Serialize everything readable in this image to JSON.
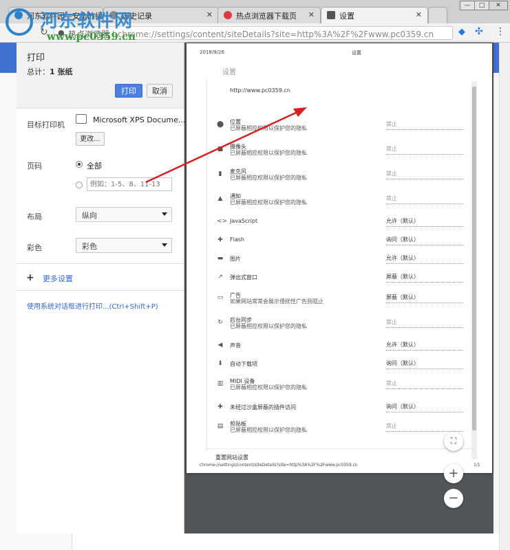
{
  "browser": {
    "tabs": [
      {
        "label": "河东软件园—安全的绿色"
      },
      {
        "label": "历史记录"
      },
      {
        "label": "热点浏览器下载页"
      },
      {
        "label": "设置"
      }
    ],
    "address_prefix": "热点浏览器",
    "address_sep": "|",
    "address_url_path": "chrome://settings/content/siteDetails?site=http%3A%2F%2Fwww.pc0359.cn",
    "watermark_title": "河东软件网",
    "watermark_url": "www.pc0359.cn"
  },
  "print_panel": {
    "title": "打印",
    "total_prefix": "总计：",
    "total_value": "1 张纸",
    "print_button": "打印",
    "cancel_button": "取消",
    "destination_label": "目标打印机",
    "destination_value": "Microsoft XPS Docume...",
    "change_button": "更改...",
    "pages_label": "页码",
    "pages_all": "全部",
    "pages_placeholder": "例如：1-5、8、11-13",
    "layout_label": "布局",
    "layout_value": "纵向",
    "color_label": "彩色",
    "color_value": "彩色",
    "more_settings": "更多设置",
    "system_dialog_link": "使用系统对话框进行打印...(Ctrl+Shift+P)"
  },
  "preview": {
    "date": "2018/9/26",
    "header_title": "设置",
    "breadcrumb": "设置",
    "site": "http://www.pc0359.cn",
    "rows": [
      {
        "icon": "location-icon",
        "glyph": "⬤",
        "name": "位置",
        "desc": "已屏蔽相应权限以保护您的隐私",
        "value": "禁止",
        "off": true
      },
      {
        "icon": "camera-icon",
        "glyph": "■",
        "name": "摄像头",
        "desc": "已屏蔽相应权限以保护您的隐私",
        "value": "禁止",
        "off": true
      },
      {
        "icon": "microphone-icon",
        "glyph": "▮",
        "name": "麦克风",
        "desc": "已屏蔽相应权限以保护您的隐私",
        "value": "禁止",
        "off": true
      },
      {
        "icon": "bell-icon",
        "glyph": "▲",
        "name": "通知",
        "desc": "已屏蔽相应权限以保护您的隐私",
        "value": "禁止",
        "off": true
      },
      {
        "icon": "code-icon",
        "glyph": "<>",
        "name": "JavaScript",
        "desc": "",
        "value": "允许（默认）",
        "off": false
      },
      {
        "icon": "puzzle-icon",
        "glyph": "✚",
        "name": "Flash",
        "desc": "",
        "value": "询问（默认）",
        "off": false
      },
      {
        "icon": "image-icon",
        "glyph": "▬",
        "name": "图片",
        "desc": "",
        "value": "允许（默认）",
        "off": false
      },
      {
        "icon": "popup-icon",
        "glyph": "↗",
        "name": "弹出式窗口",
        "desc": "",
        "value": "屏蔽（默认）",
        "off": false
      },
      {
        "icon": "ad-icon",
        "glyph": "▭",
        "name": "广告",
        "desc": "如果网站常常会展示侵扰性广告则阻止",
        "value": "屏蔽（默认）",
        "off": false
      },
      {
        "icon": "sync-icon",
        "glyph": "↻",
        "name": "后台同步",
        "desc": "已屏蔽相应权限以保护您的隐私",
        "value": "禁止",
        "off": true
      },
      {
        "icon": "sound-icon",
        "glyph": "◀",
        "name": "声音",
        "desc": "",
        "value": "允许（默认）",
        "off": false
      },
      {
        "icon": "download-icon",
        "glyph": "⬇",
        "name": "自动下载项",
        "desc": "",
        "value": "询问（默认）",
        "off": false
      },
      {
        "icon": "midi-icon",
        "glyph": "▥",
        "name": "MIDI 设备",
        "desc": "已屏蔽相应权限以保护您的隐私",
        "value": "禁止",
        "off": true
      },
      {
        "icon": "plugin-icon",
        "glyph": "✚",
        "name": "未经过沙盒屏蔽的插件访问",
        "desc": "",
        "value": "询问（默认）",
        "off": false
      },
      {
        "icon": "clipboard-icon",
        "glyph": "▤",
        "name": "剪贴板",
        "desc": "已屏蔽相应权限以保护您的隐私",
        "value": "禁止",
        "off": true
      }
    ],
    "reset_label": "重置网站设置",
    "footer_url": "chrome://settings/content/siteDetails?site=http%3A%2F%2Fwww.pc0359.cn",
    "footer_page": "1/1"
  },
  "colors": {
    "accent": "#3f6fd1",
    "print_button": "#4d7fe3",
    "arrow": "#d42020"
  }
}
